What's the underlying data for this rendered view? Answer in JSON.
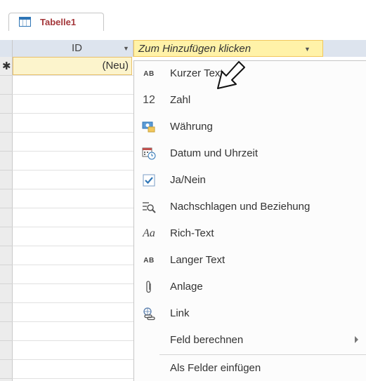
{
  "tab": {
    "label": "Tabelle1"
  },
  "header": {
    "id_label": "ID",
    "add_field_label": "Zum Hinzufügen klicken"
  },
  "new_row": {
    "marker": "✱",
    "value": "(Neu)"
  },
  "menu": {
    "items": [
      {
        "label": "Kurzer Text",
        "icon": "AB"
      },
      {
        "label": "Zahl",
        "icon": "12"
      },
      {
        "label": "Währung",
        "icon": "currency-icon"
      },
      {
        "label": "Datum und Uhrzeit",
        "icon": "calendar-clock-icon"
      },
      {
        "label": "Ja/Nein",
        "icon": "checkbox-icon"
      },
      {
        "label": "Nachschlagen und Beziehung",
        "icon": "lookup-icon"
      },
      {
        "label": "Rich-Text",
        "icon": "Aa"
      },
      {
        "label": "Langer Text",
        "icon": "AB"
      },
      {
        "label": "Anlage",
        "icon": "paperclip-icon"
      },
      {
        "label": "Link",
        "icon": "link-icon"
      },
      {
        "label": "Feld berechnen",
        "icon": ""
      },
      {
        "label": "Als Felder einfügen",
        "icon": ""
      }
    ]
  }
}
